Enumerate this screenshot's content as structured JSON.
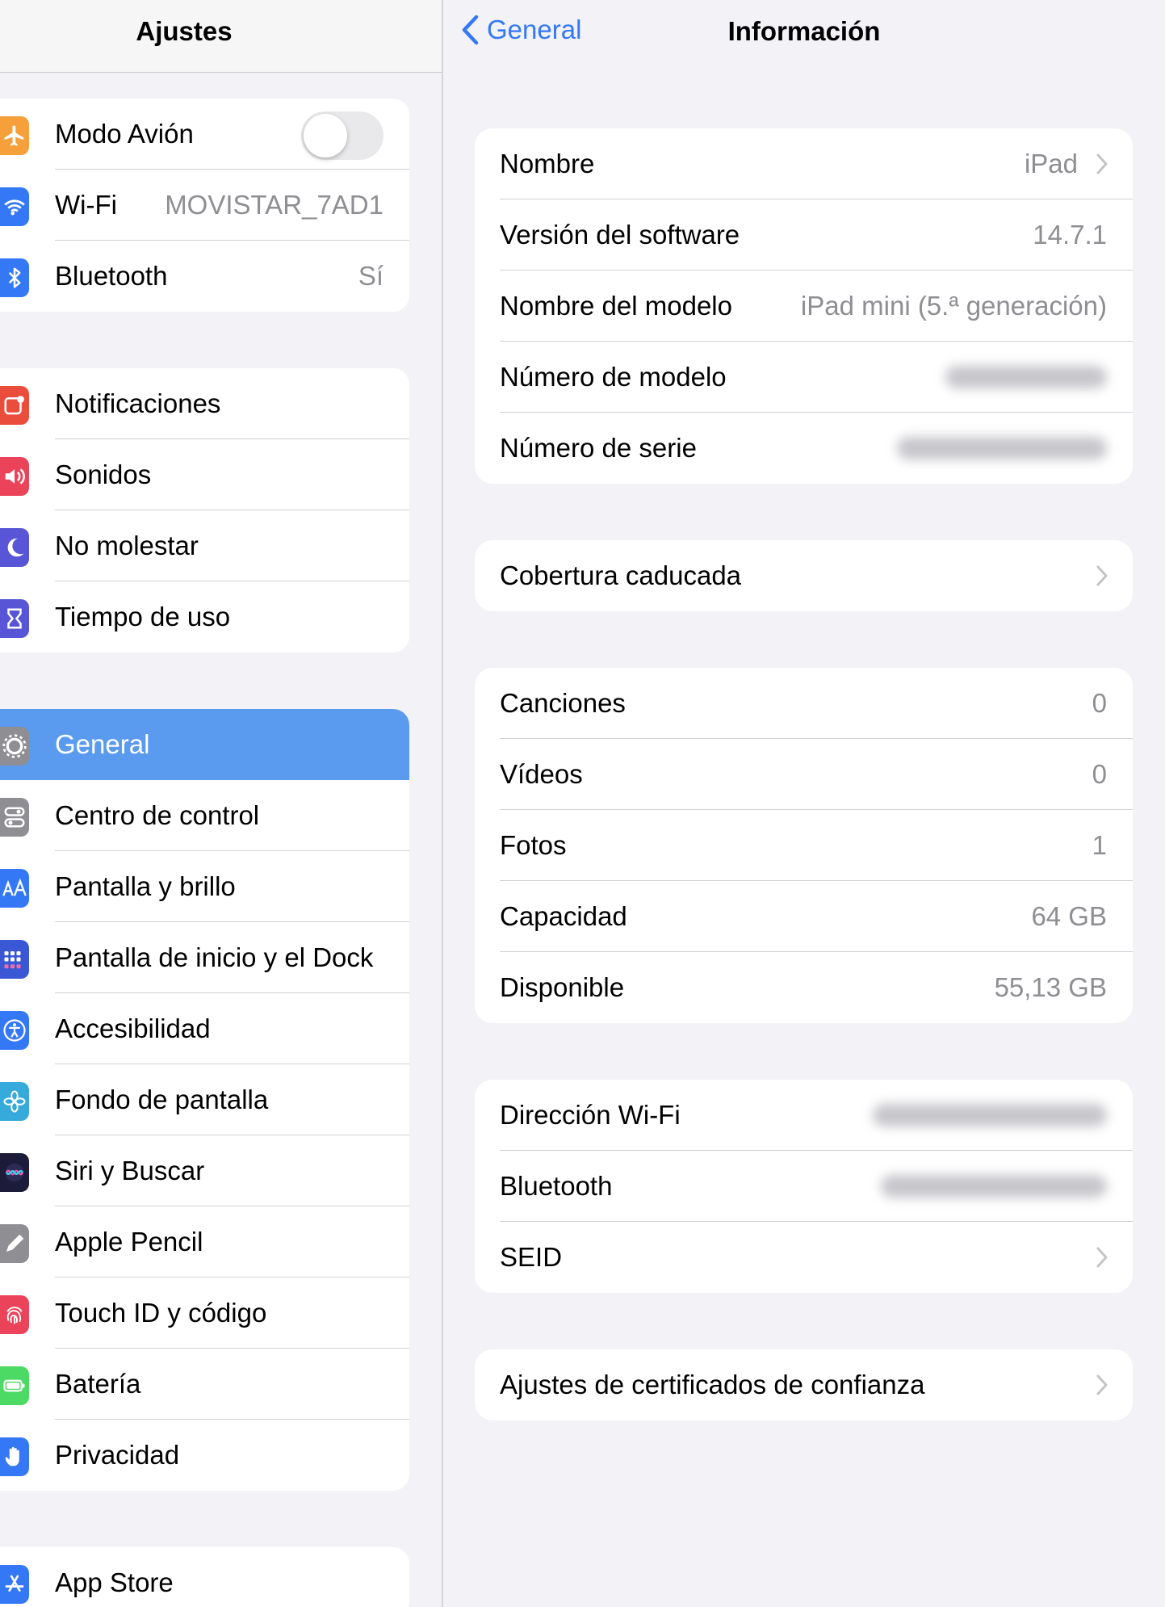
{
  "left": {
    "title": "Ajustes",
    "group1": [
      {
        "label": "Modo Avión",
        "icon": "airplane-icon",
        "color": "#f5a03a",
        "toggle": false
      },
      {
        "label": "Wi-Fi",
        "value": "MOVISTAR_7AD1",
        "icon": "wifi-icon",
        "color": "#3478f6"
      },
      {
        "label": "Bluetooth",
        "value": "Sí",
        "icon": "bluetooth-icon",
        "color": "#3478f6"
      }
    ],
    "group2": [
      {
        "label": "Notificaciones",
        "icon": "notifications-icon",
        "color": "#eb4d3d"
      },
      {
        "label": "Sonidos",
        "icon": "sounds-icon",
        "color": "#eb445a"
      },
      {
        "label": "No molestar",
        "icon": "moon-icon",
        "color": "#5856d6"
      },
      {
        "label": "Tiempo de uso",
        "icon": "hourglass-icon",
        "color": "#5856d6"
      }
    ],
    "group3": [
      {
        "label": "General",
        "icon": "gear-icon",
        "color": "#8e8e93",
        "selected": true
      },
      {
        "label": "Centro de control",
        "icon": "switches-icon",
        "color": "#8e8e93"
      },
      {
        "label": "Pantalla y brillo",
        "icon": "text-size-icon",
        "color": "#3478f6"
      },
      {
        "label": "Pantalla de inicio y el Dock",
        "icon": "home-grid-icon",
        "color": "#3a57d6"
      },
      {
        "label": "Accesibilidad",
        "icon": "accessibility-icon",
        "color": "#3478f6"
      },
      {
        "label": "Fondo de pantalla",
        "icon": "flower-icon",
        "color": "#37aadc"
      },
      {
        "label": "Siri y Buscar",
        "icon": "siri-icon",
        "color": "#1c1c3a"
      },
      {
        "label": "Apple Pencil",
        "icon": "pencil-icon",
        "color": "#8e8e93"
      },
      {
        "label": "Touch ID y código",
        "icon": "fingerprint-icon",
        "color": "#eb445a"
      },
      {
        "label": "Batería",
        "icon": "battery-icon",
        "color": "#4cd964"
      },
      {
        "label": "Privacidad",
        "icon": "hand-icon",
        "color": "#3478f6"
      }
    ],
    "group4": [
      {
        "label": "App Store",
        "icon": "app-store-icon",
        "color": "#3478f6"
      }
    ]
  },
  "right": {
    "back_label": "General",
    "title": "Información",
    "group1": [
      {
        "label": "Nombre",
        "value": "iPad",
        "chevron": true
      },
      {
        "label": "Versión del software",
        "value": "14.7.1"
      },
      {
        "label": "Nombre del modelo",
        "value": "iPad mini (5.ª generación)"
      },
      {
        "label": "Número de modelo",
        "redacted": true
      },
      {
        "label": "Número de serie",
        "redacted": true
      }
    ],
    "group2": [
      {
        "label": "Cobertura caducada",
        "chevron": true
      }
    ],
    "group3": [
      {
        "label": "Canciones",
        "value": "0"
      },
      {
        "label": "Vídeos",
        "value": "0"
      },
      {
        "label": "Fotos",
        "value": "1"
      },
      {
        "label": "Capacidad",
        "value": "64 GB"
      },
      {
        "label": "Disponible",
        "value": "55,13 GB"
      }
    ],
    "group4": [
      {
        "label": "Dirección Wi-Fi",
        "redacted": true
      },
      {
        "label": "Bluetooth",
        "redacted": true
      },
      {
        "label": "SEID",
        "chevron": true
      }
    ],
    "group5": [
      {
        "label": "Ajustes de certificados de confianza",
        "chevron": true
      }
    ]
  },
  "colors": {
    "accent": "#3478f6",
    "selected_row": "#5a9bf0",
    "secondary_text": "#8e8e93",
    "background": "#f2f2f7"
  }
}
